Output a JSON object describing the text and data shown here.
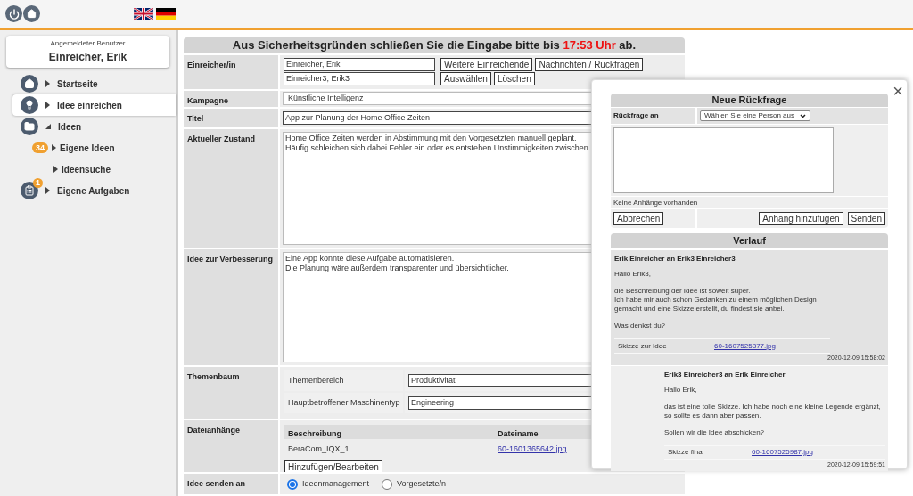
{
  "user_card": {
    "caption": "Angemeldeter Benutzer",
    "name": "Einreicher, Erik"
  },
  "nav": [
    {
      "label": "Startseite",
      "selected": false,
      "expanded": false
    },
    {
      "label": "Idee einreichen",
      "selected": true,
      "expanded": false
    },
    {
      "label": "Ideen",
      "selected": false,
      "expanded": true,
      "children": [
        {
          "label": "Eigene Ideen",
          "badge": "34",
          "selected": false,
          "expanded": false
        },
        {
          "label": "Ideensuche",
          "selected": false,
          "expanded": false
        }
      ]
    },
    {
      "label": "Eigene Aufgaben",
      "badge": "1",
      "selected": false,
      "expanded": false
    }
  ],
  "form": {
    "notice": "Aus Sicherheitsgründen schließen Sie die Eingabe bitte bis",
    "deadline": "17:53 Uhr",
    "notice_end": "ab.",
    "rows": [
      {
        "kind": "submitters",
        "label": "Einreicher/in",
        "values": [
          "Einreicher, Erik",
          "Einreicher3, Erik3"
        ],
        "buttons": [
          [
            "Weitere Einreichende",
            "Nachrichten / Rückfragen"
          ],
          [
            "Auswählen",
            "Löschen"
          ]
        ]
      },
      {
        "kind": "select",
        "label": "Kampagne",
        "value": "Künstliche Intelligenz"
      },
      {
        "kind": "input",
        "label": "Titel",
        "value": "App zur Planung der Home Office Zeiten"
      },
      {
        "kind": "textarea",
        "label": "Aktueller Zustand",
        "value": "Home Office Zeiten werden in Abstimmung mit den Vorgesetzten manuell geplant.\nHäufig schleichen sich dabei Fehler ein oder es entstehen Unstimmigkeiten zwischen"
      },
      {
        "kind": "textarea",
        "label": "Idee zur Verbesserung",
        "value": "Eine App könnte diese Aufgabe automatisieren.\nDie Planung wäre außerdem transparenter und übersichtlicher."
      },
      {
        "kind": "topics",
        "label": "Themenbaum",
        "fields": [
          {
            "label": "Themenbereich",
            "value": "Produktivität"
          },
          {
            "label": "Hauptbetroffener Maschinentyp",
            "value": "Engineering"
          }
        ]
      },
      {
        "kind": "attachments",
        "label": "Dateianhänge",
        "columns": [
          "Beschreibung",
          "Dateiname"
        ],
        "files": [
          {
            "description": "BeraCom_IQX_1",
            "file": "60-1601365642.jpg"
          }
        ],
        "button": "Hinzufügen/Bearbeiten"
      },
      {
        "kind": "radio",
        "label": "Idee senden an",
        "options": [
          {
            "label": "Ideenmanagement",
            "selected": true
          },
          {
            "label": "Vorgesetzte/n",
            "selected": false
          }
        ]
      }
    ]
  },
  "dialog": {
    "close": "×",
    "title": "Neue Rückfrage",
    "recipient_label": "Rückfrage an",
    "recipient_select": "Wählen Sie eine Person aus",
    "attachments_note": "Keine Anhänge vorhanden",
    "cancel": "Abbrechen",
    "actions": [
      "Anhang hinzufügen",
      "Senden"
    ],
    "history_title": "Verlauf",
    "messages": [
      {
        "header": "Erik Einreicher an Erik3 Einreicher3",
        "paragraphs": [
          "Hallo Erik3,",
          "die Beschreibung der Idee ist soweit super.\nIch habe mir auch schon Gedanken zu einem möglichen Design\ngemacht und eine Skizze erstellt, du findest sie anbei.",
          "Was denkst du?"
        ],
        "attachment_label": "Skizze zur Idee",
        "attachment_file": "60-1607525877.jpg",
        "timestamp": "2020-12-09 15:58:02"
      },
      {
        "header": "Erik3 Einreicher3 an Erik Einreicher",
        "paragraphs": [
          "Hallo Erik,",
          "das ist eine tolle Skizze. Ich habe noch eine kleine Legende ergänzt,\nso sollte es dann aber passen.",
          "Sollen wir die Idee abschicken?"
        ],
        "attachment_label": "Skizze final",
        "attachment_file": "60-1607525987.jpg",
        "timestamp": "2020-12-09 15:59:51"
      }
    ]
  }
}
